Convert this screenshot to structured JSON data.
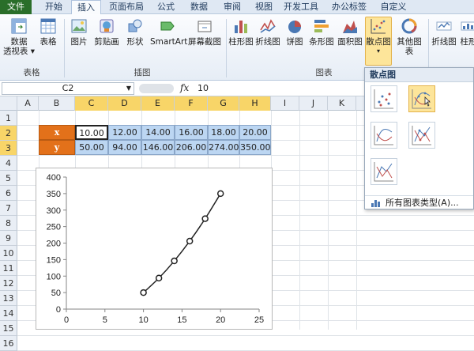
{
  "menu": {
    "tabs": [
      {
        "label": "文件"
      },
      {
        "label": "开始"
      },
      {
        "label": "插入"
      },
      {
        "label": "页面布局"
      },
      {
        "label": "公式"
      },
      {
        "label": "数据"
      },
      {
        "label": "审阅"
      },
      {
        "label": "视图"
      },
      {
        "label": "开发工具"
      },
      {
        "label": "办公标签"
      },
      {
        "label": "自定义"
      }
    ]
  },
  "ribbon": {
    "buttons": [
      {
        "label": "数据\n透视表 ▾",
        "icon": "pivot-table-icon"
      },
      {
        "label": "表格",
        "icon": "table-icon"
      },
      {
        "label": "图片",
        "icon": "picture-icon"
      },
      {
        "label": "剪贴画",
        "icon": "clipart-icon"
      },
      {
        "label": "形状",
        "icon": "shapes-icon"
      },
      {
        "label": "SmartArt",
        "icon": "smartart-icon"
      },
      {
        "label": "屏幕截图",
        "icon": "screenshot-icon"
      },
      {
        "label": "柱形图",
        "icon": "column-chart-icon"
      },
      {
        "label": "折线图",
        "icon": "line-chart-icon"
      },
      {
        "label": "饼图",
        "icon": "pie-chart-icon"
      },
      {
        "label": "条形图",
        "icon": "bar-chart-icon"
      },
      {
        "label": "面积图",
        "icon": "area-chart-icon"
      },
      {
        "label": "散点图",
        "icon": "scatter-chart-icon"
      },
      {
        "label": "其他图表",
        "icon": "other-charts-icon"
      },
      {
        "label": "折线图",
        "icon": "sparkline-line-icon"
      },
      {
        "label": "柱形",
        "icon": "sparkline-column-icon"
      }
    ],
    "groups": [
      {
        "label": "表格"
      },
      {
        "label": "插图"
      },
      {
        "label": "图表"
      }
    ]
  },
  "formula_bar": {
    "name_box": "C2",
    "fx": "fx",
    "value": "10"
  },
  "grid": {
    "columns": [
      "A",
      "B",
      "C",
      "D",
      "E",
      "F",
      "G",
      "H",
      "I",
      "J",
      "K"
    ],
    "rows": [
      "1",
      "2",
      "3",
      "4",
      "5",
      "6",
      "7",
      "8",
      "9",
      "10",
      "11",
      "12",
      "13",
      "14",
      "15",
      "16"
    ],
    "table": {
      "x_label": "x",
      "y_label": "y",
      "x_values": [
        "10.00",
        "12.00",
        "14.00",
        "16.00",
        "18.00",
        "20.00"
      ],
      "y_values": [
        "50.00",
        "94.00",
        "146.00",
        "206.00",
        "274.00",
        "350.00"
      ]
    }
  },
  "chart_data": {
    "type": "scatter",
    "x": [
      10,
      12,
      14,
      16,
      18,
      20
    ],
    "y": [
      50,
      94,
      146,
      206,
      274,
      350
    ],
    "xlim": [
      0,
      25
    ],
    "ylim": [
      0,
      400
    ],
    "xticks": [
      0,
      5,
      10,
      15,
      20,
      25
    ],
    "yticks": [
      0,
      50,
      100,
      150,
      200,
      250,
      300,
      350,
      400
    ],
    "smooth_line": true,
    "markers": "circle",
    "grid": false,
    "title": "",
    "xlabel": "",
    "ylabel": ""
  },
  "dropdown": {
    "title": "散点图",
    "options": [
      {
        "icon": "scatter-markers-only-icon"
      },
      {
        "icon": "scatter-smooth-lines-markers-icon"
      },
      {
        "icon": "scatter-smooth-lines-icon"
      },
      {
        "icon": "scatter-straight-lines-markers-icon"
      },
      {
        "icon": "scatter-straight-lines-icon"
      }
    ],
    "all_types": "所有图表类型(A)..."
  },
  "colors": {
    "accent": "#e3711a",
    "selected": "#fde59a",
    "header_highlight": "#f8d568",
    "cell_blue": "#bcd6f2"
  }
}
